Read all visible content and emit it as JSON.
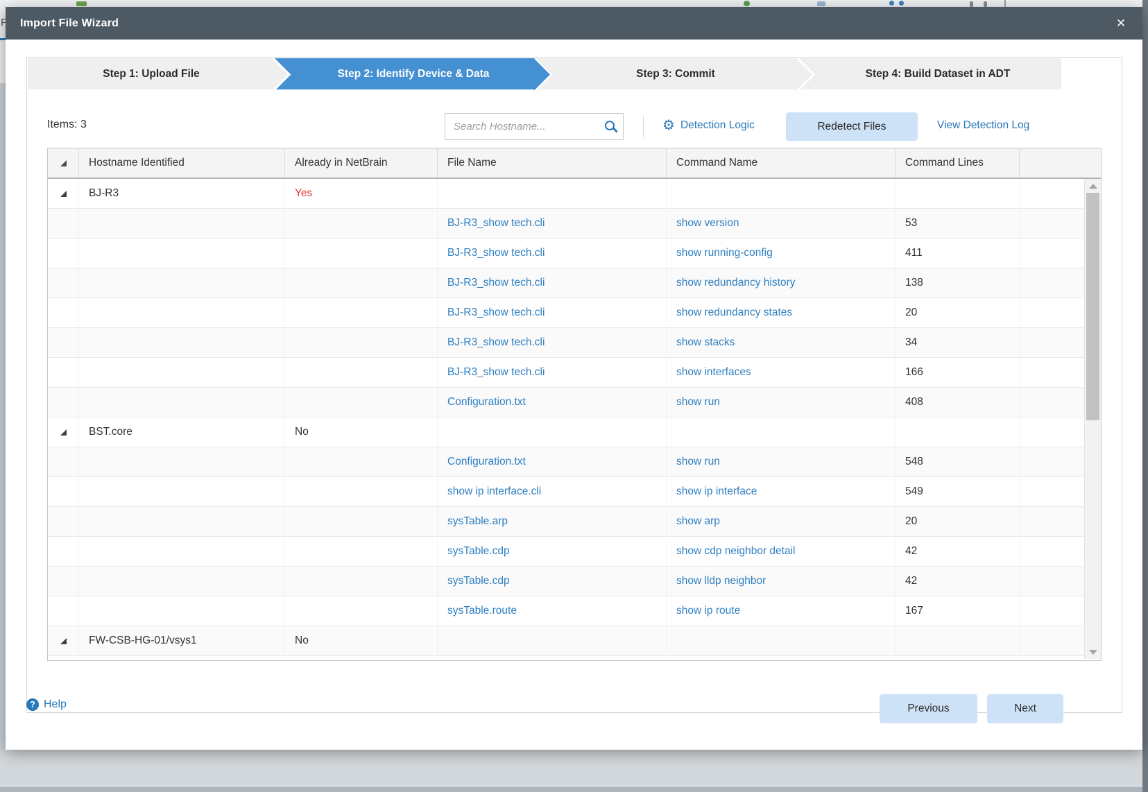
{
  "dialog": {
    "title": "Import File Wizard",
    "close_icon": "✕"
  },
  "steps": {
    "items": [
      "Step 1: Upload File",
      "Step 2: Identify Device & Data",
      "Step 3: Commit",
      "Step 4: Build Dataset in ADT"
    ],
    "active_index": 1
  },
  "toolbar": {
    "items_label": "Items: 3",
    "search_placeholder": "Search Hostname...",
    "detection_logic_label": "Detection Logic",
    "gear_glyph": "⚙",
    "redetect_label": "Redetect Files",
    "view_log_label": "View Detection Log"
  },
  "grid": {
    "headers": {
      "hostname": "Hostname Identified",
      "already": "Already in NetBrain",
      "file": "File Name",
      "command": "Command Name",
      "lines": "Command Lines"
    },
    "groups": [
      {
        "hostname": "BJ-R3",
        "already": "Yes",
        "rows": [
          {
            "file": "BJ-R3_show tech.cli",
            "command": "show version",
            "lines": "53"
          },
          {
            "file": "BJ-R3_show tech.cli",
            "command": "show running-config",
            "lines": "411"
          },
          {
            "file": "BJ-R3_show tech.cli",
            "command": "show redundancy history",
            "lines": "138"
          },
          {
            "file": "BJ-R3_show tech.cli",
            "command": "show redundancy states",
            "lines": "20"
          },
          {
            "file": "BJ-R3_show tech.cli",
            "command": "show stacks",
            "lines": "34"
          },
          {
            "file": "BJ-R3_show tech.cli",
            "command": "show interfaces",
            "lines": "166"
          },
          {
            "file": "Configuration.txt",
            "command": "show run",
            "lines": "408"
          }
        ]
      },
      {
        "hostname": "BST.core",
        "already": "No",
        "rows": [
          {
            "file": "Configuration.txt",
            "command": "show run",
            "lines": "548"
          },
          {
            "file": "show ip interface.cli",
            "command": "show ip interface",
            "lines": "549"
          },
          {
            "file": "sysTable.arp",
            "command": "show arp",
            "lines": "20"
          },
          {
            "file": "sysTable.cdp",
            "command": "show cdp neighbor detail",
            "lines": "42"
          },
          {
            "file": "sysTable.cdp",
            "command": "show lldp neighbor",
            "lines": "42"
          },
          {
            "file": "sysTable.route",
            "command": "show ip route",
            "lines": "167"
          }
        ]
      },
      {
        "hostname": "FW-CSB-HG-01/vsys1",
        "already": "No",
        "rows": []
      }
    ]
  },
  "footer": {
    "help_label": "Help",
    "help_glyph": "?",
    "previous_label": "Previous",
    "next_label": "Next"
  },
  "palette": {
    "titlebar": "#4d5a64",
    "step_active": "#4590d2",
    "link_blue": "#2878ba",
    "file_link_blue": "#2e7fc1",
    "warning_red": "#e8342e",
    "button_light_blue": "#cde2f7"
  }
}
